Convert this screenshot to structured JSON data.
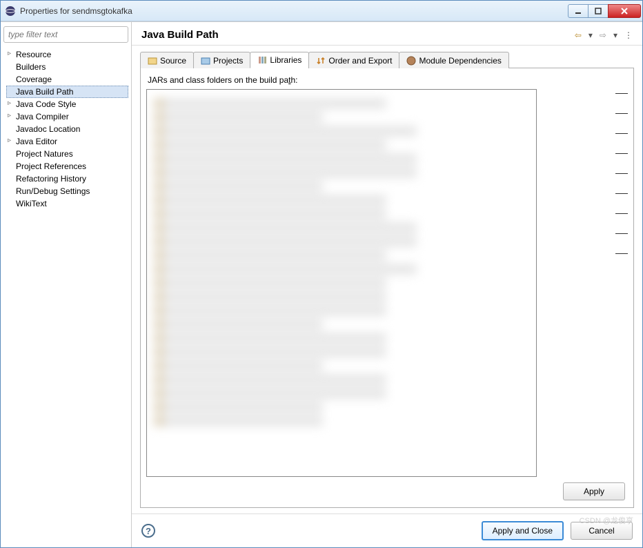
{
  "window": {
    "title": "Properties for sendmsgtokafka"
  },
  "filter": {
    "placeholder": "type filter text"
  },
  "tree": {
    "items": [
      {
        "label": "Resource",
        "children": true
      },
      {
        "label": "Builders",
        "children": false
      },
      {
        "label": "Coverage",
        "children": false
      },
      {
        "label": "Java Build Path",
        "children": false,
        "selected": true
      },
      {
        "label": "Java Code Style",
        "children": true
      },
      {
        "label": "Java Compiler",
        "children": true
      },
      {
        "label": "Javadoc Location",
        "children": false
      },
      {
        "label": "Java Editor",
        "children": true
      },
      {
        "label": "Project Natures",
        "children": false
      },
      {
        "label": "Project References",
        "children": false
      },
      {
        "label": "Refactoring History",
        "children": false
      },
      {
        "label": "Run/Debug Settings",
        "children": false
      },
      {
        "label": "WikiText",
        "children": false
      }
    ]
  },
  "header": {
    "title": "Java Build Path"
  },
  "tabs": [
    {
      "label": "Source",
      "icon": "source-icon"
    },
    {
      "label": "Projects",
      "icon": "projects-icon"
    },
    {
      "label": "Libraries",
      "icon": "libraries-icon",
      "active": true
    },
    {
      "label": "Order and Export",
      "icon": "order-icon"
    },
    {
      "label": "Module Dependencies",
      "icon": "module-icon"
    }
  ],
  "pane": {
    "label_pre": "JARs and class folders on the build pa",
    "label_underline": "t",
    "label_post": "h:"
  },
  "buttons": {
    "apply": "Apply",
    "apply_close": "Apply and Close",
    "cancel": "Cancel"
  },
  "watermark": "CSDN @龙俊亨"
}
